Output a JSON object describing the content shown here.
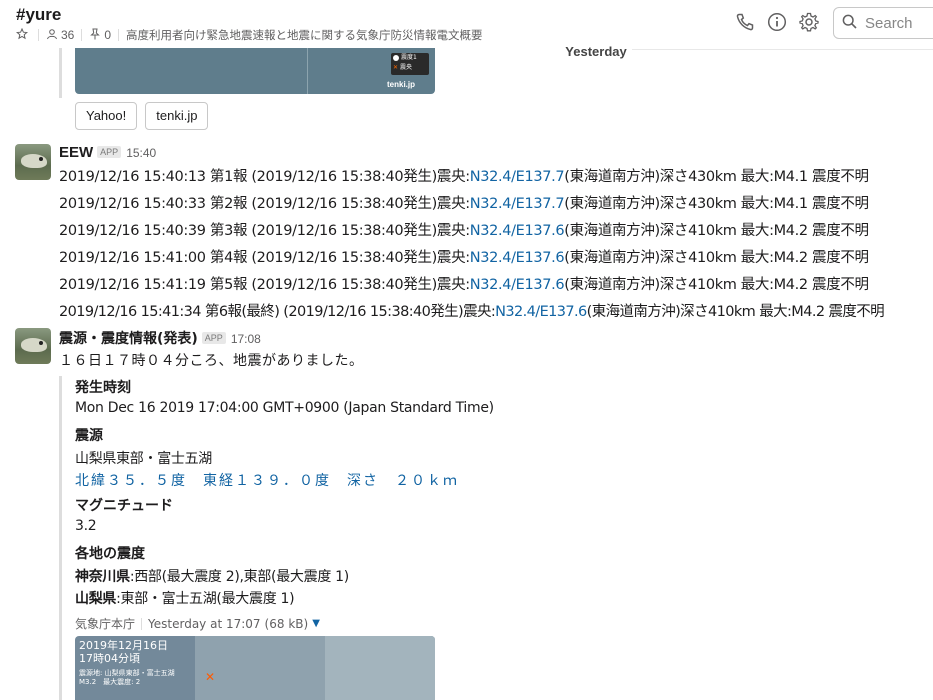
{
  "header": {
    "channel": "#yure",
    "members": "36",
    "pins": "0",
    "topic": "高度利用者向け緊急地震速報と地震に関する気象庁防災情報電文概要",
    "search_placeholder": "Search"
  },
  "divider": {
    "label": "Yesterday"
  },
  "top_attachment": {
    "legend_line1": "震度1",
    "legend_line2": "震央",
    "brand": "tenki.jp",
    "buttons": [
      "Yahoo!",
      "tenki.jp"
    ]
  },
  "eew": {
    "name": "EEW",
    "app_badge": "APP",
    "time": "15:40",
    "lines": [
      {
        "pre": "2019/12/16 15:40:13 第1報 (2019/12/16 15:38:40発生)震央:",
        "link": "N32.4/E137.7",
        "post": "(東海道南方沖)深さ430km 最大:M4.1 震度不明"
      },
      {
        "pre": "2019/12/16 15:40:33 第2報 (2019/12/16 15:38:40発生)震央:",
        "link": "N32.4/E137.7",
        "post": "(東海道南方沖)深さ430km 最大:M4.1 震度不明"
      },
      {
        "pre": "2019/12/16 15:40:39 第3報 (2019/12/16 15:38:40発生)震央:",
        "link": "N32.4/E137.6",
        "post": "(東海道南方沖)深さ410km 最大:M4.2 震度不明"
      },
      {
        "pre": "2019/12/16 15:41:00 第4報 (2019/12/16 15:38:40発生)震央:",
        "link": "N32.4/E137.6",
        "post": "(東海道南方沖)深さ410km 最大:M4.2 震度不明"
      },
      {
        "pre": "2019/12/16 15:41:19 第5報 (2019/12/16 15:38:40発生)震央:",
        "link": "N32.4/E137.6",
        "post": "(東海道南方沖)深さ410km 最大:M4.2 震度不明"
      },
      {
        "pre": "2019/12/16 15:41:34 第6報(最終) (2019/12/16 15:38:40発生)震央:",
        "link": "N32.4/E137.6",
        "post": "(東海道南方沖)深さ410km 最大:M4.2 震度不明"
      }
    ]
  },
  "quake": {
    "name": "震源・震度情報(発表)",
    "app_badge": "APP",
    "time": "17:08",
    "body": "１６日１７時０４分ころ、地震がありました。",
    "fields": {
      "time_title": "発生時刻",
      "time_value": "Mon Dec 16 2019 17:04:00 GMT+0900 (Japan Standard Time)",
      "source_title": "震源",
      "source_value": "山梨県東部・富士五湖",
      "coords": "北緯３５．５度　東経１３９．０度　深さ　２０ｋｍ",
      "mag_title": "マグニチュード",
      "mag_value": "3.2",
      "local_title": "各地の震度",
      "pref1": "神奈川県",
      "pref1_value": ":西部(最大震度 2),東部(最大震度 1)",
      "pref2": "山梨県",
      "pref2_value": ":東部・富士五湖(最大震度 1)"
    },
    "file": {
      "source": "気象庁本庁",
      "time": "Yesterday at 17:07",
      "size": "(68 kB)"
    },
    "map": {
      "date": "2019年12月16日",
      "time": "17時04分頃",
      "sub1": "震源地: 山梨県東部・富士五湖",
      "sub2": "M3.2　最大震度: 2"
    }
  }
}
